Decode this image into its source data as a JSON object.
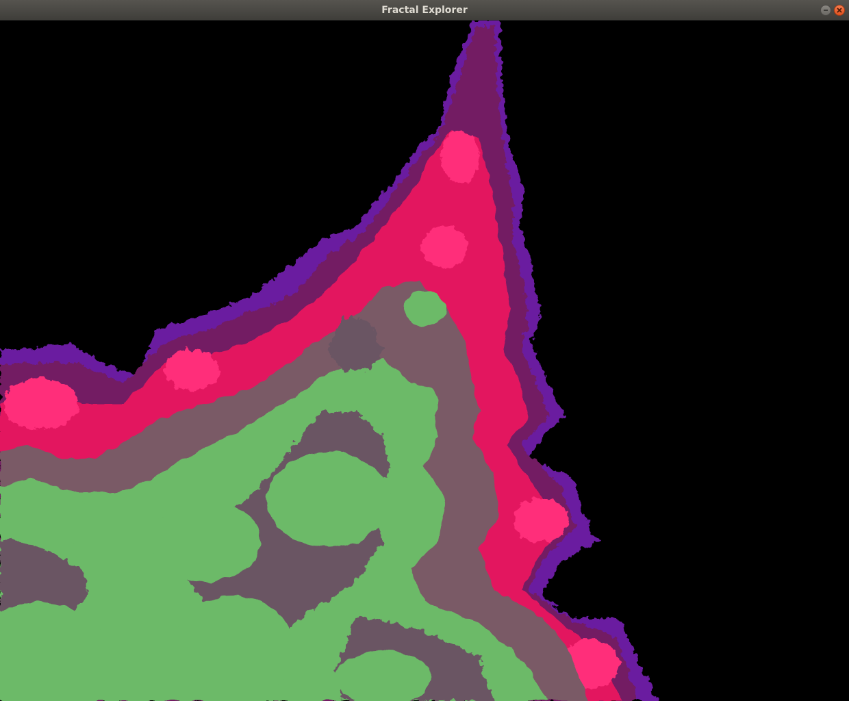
{
  "window": {
    "title": "Fractal Explorer"
  },
  "icons": {
    "minimize": "minimize-icon",
    "close": "close-icon"
  },
  "palette": {
    "background": "#000000",
    "violet": "#6a1fa0",
    "purple": "#8a1f8a",
    "dark_magenta": "#731a63",
    "magenta": "#e3195f",
    "pink": "#ff2d7a",
    "taupe": "#6b5563",
    "mauve": "#7a5a66",
    "green": "#6cba68",
    "titlebar": "#4a4844",
    "close_accent": "#e95420"
  }
}
